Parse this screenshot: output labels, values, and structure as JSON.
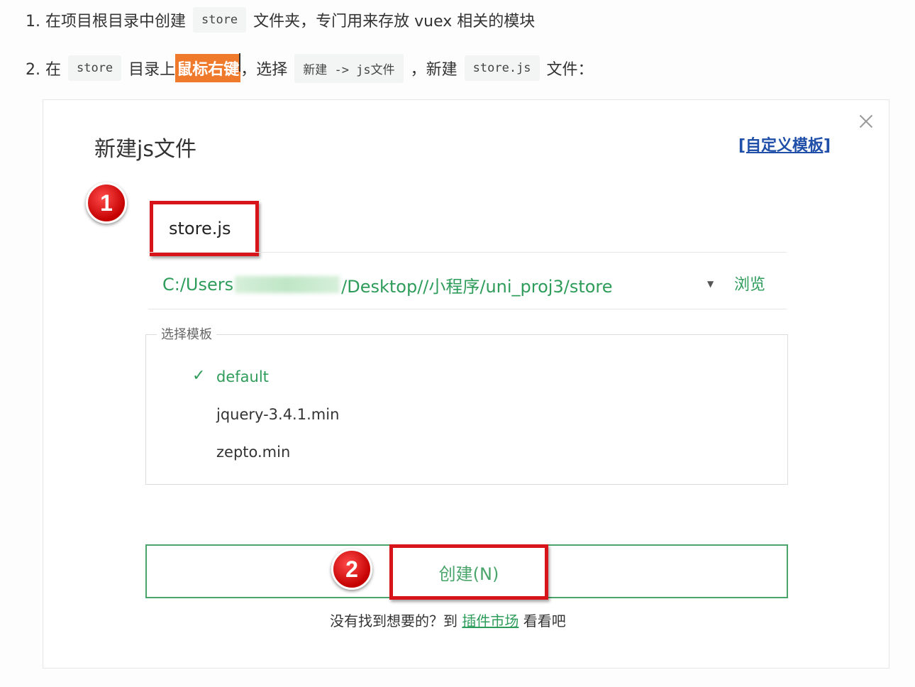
{
  "instructions": {
    "line1": {
      "prefix": "1. 在项目根目录中创建",
      "code": "store",
      "suffix": "文件夹，专门用来存放 vuex 相关的模块"
    },
    "line2": {
      "prefix": "2. 在",
      "code1": "store",
      "mid1": "目录上",
      "highlight": "鼠标右键",
      "mid2": "，选择",
      "code2": "新建 -> js文件",
      "mid3": "，新建",
      "code3": "store.js",
      "suffix": "文件："
    }
  },
  "dialog": {
    "title": "新建js文件",
    "custom_template_link": "[自定义模板]",
    "filename_value": "store.js",
    "path_prefix": "C:/Users",
    "path_suffix": "/Desktop//小程序/uni_proj3/store",
    "browse_label": "浏览",
    "template_legend": "选择模板",
    "templates": [
      {
        "label": "default",
        "selected": true
      },
      {
        "label": "jquery-3.4.1.min",
        "selected": false
      },
      {
        "label": "zepto.min",
        "selected": false
      }
    ],
    "create_button": "创建(N)",
    "hint_prefix": "没有找到想要的？到",
    "hint_link": "插件市场",
    "hint_suffix": "看看吧"
  },
  "annotations": {
    "step1": "1",
    "step2": "2"
  },
  "colors": {
    "accent_green": "#2e9c5a",
    "annotation_red": "#d8141b",
    "highlight_orange": "#f07a2c",
    "link_blue": "#1f4fa8"
  }
}
